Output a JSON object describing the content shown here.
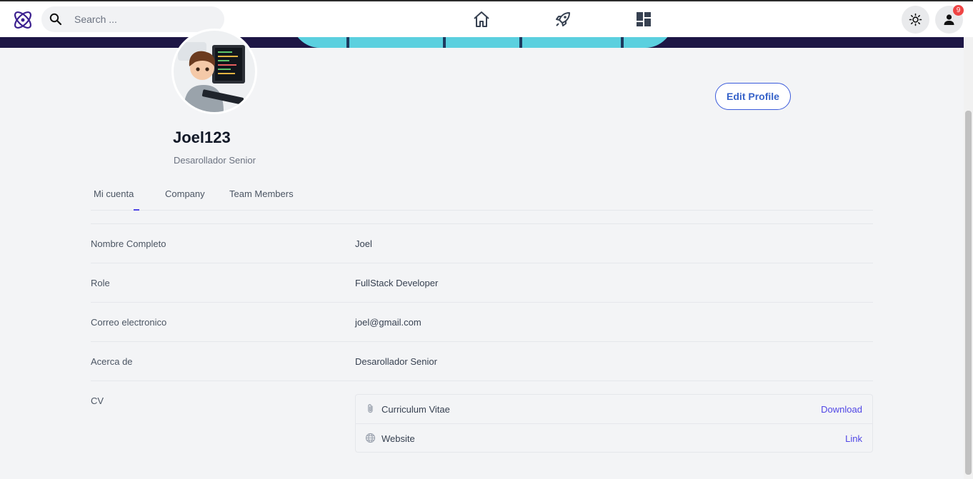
{
  "search": {
    "placeholder": "Search ..."
  },
  "header": {
    "notification_count": "9",
    "nav": [
      "home-icon",
      "rocket-icon",
      "dashboard-icon"
    ],
    "accent": "#4f46e5"
  },
  "profile": {
    "username": "Joel123",
    "subtitle": "Desarollador Senior",
    "edit_label": "Edit Profile"
  },
  "tabs": [
    {
      "label": "Mi cuenta"
    },
    {
      "label": "Company"
    },
    {
      "label": "Team Members"
    }
  ],
  "details": [
    {
      "label": "Nombre Completo",
      "value": "Joel"
    },
    {
      "label": "Role",
      "value": "FullStack Developer"
    },
    {
      "label": "Correo electronico",
      "value": "joel@gmail.com"
    },
    {
      "label": "Acerca de",
      "value": "Desarollador Senior"
    },
    {
      "label": "CV"
    }
  ],
  "attachments": [
    {
      "name": "Curriculum Vitae",
      "action": "Download",
      "icon": "paperclip-icon"
    },
    {
      "name": "Website",
      "action": "Link",
      "icon": "globe-icon"
    }
  ]
}
